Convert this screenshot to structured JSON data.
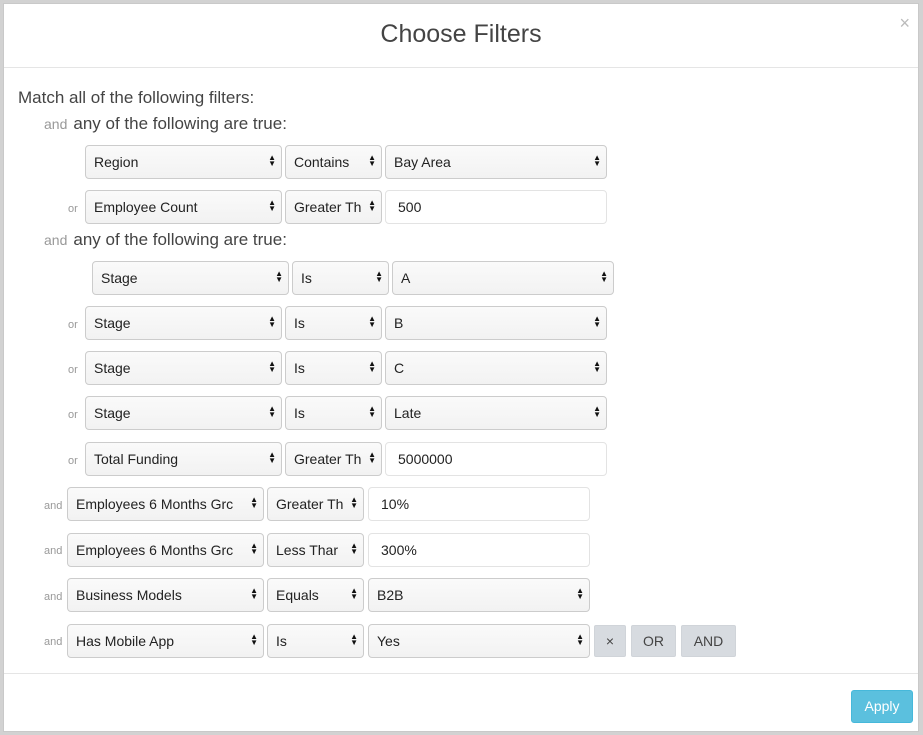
{
  "modal": {
    "title": "Choose Filters",
    "close_label": "×",
    "match_label": "Match all of the following filters:",
    "apply_label": "Apply"
  },
  "groups": [
    {
      "conjunction": "and",
      "label": "any of the following are true:",
      "rows": [
        {
          "conj": "",
          "field": "Region",
          "op": "Contains",
          "value": "Bay Area",
          "value_type": "select"
        },
        {
          "conj": "or",
          "field": "Employee Count",
          "op": "Greater Th",
          "value": "500",
          "value_type": "input"
        }
      ]
    },
    {
      "conjunction": "and",
      "label": "any of the following are true:",
      "rows": [
        {
          "conj": "",
          "field": "Stage",
          "op": "Is",
          "value": "A",
          "value_type": "select"
        },
        {
          "conj": "or",
          "field": "Stage",
          "op": "Is",
          "value": "B",
          "value_type": "select"
        },
        {
          "conj": "or",
          "field": "Stage",
          "op": "Is",
          "value": "C",
          "value_type": "select"
        },
        {
          "conj": "or",
          "field": "Stage",
          "op": "Is",
          "value": "Late",
          "value_type": "select"
        },
        {
          "conj": "or",
          "field": "Total Funding",
          "op": "Greater Th",
          "value": "5000000",
          "value_type": "input"
        }
      ]
    }
  ],
  "top_rows": [
    {
      "conj": "and",
      "field": "Employees 6 Months Grc",
      "op": "Greater Th",
      "value": "10%",
      "value_type": "input"
    },
    {
      "conj": "and",
      "field": "Employees 6 Months Grc",
      "op": "Less Thar",
      "value": "300%",
      "value_type": "input"
    },
    {
      "conj": "and",
      "field": "Business Models",
      "op": "Equals",
      "value": "B2B",
      "value_type": "select"
    },
    {
      "conj": "and",
      "field": "Has Mobile App",
      "op": "Is",
      "value": "Yes",
      "value_type": "select"
    }
  ],
  "row_buttons": {
    "remove_label": "×",
    "or_label": "OR",
    "and_label": "AND"
  }
}
